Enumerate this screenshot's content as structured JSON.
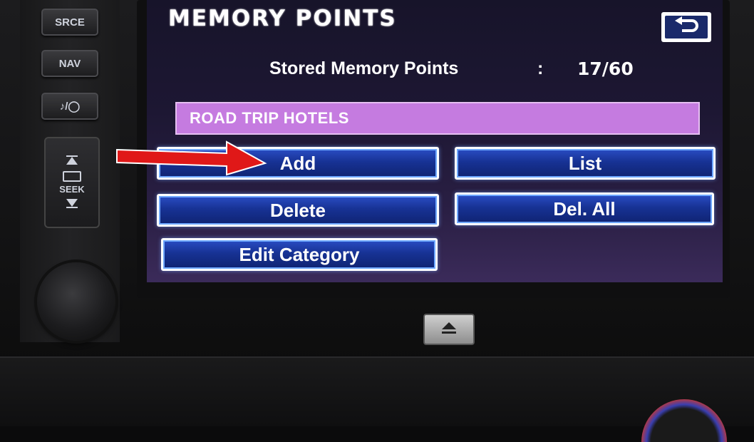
{
  "hardware": {
    "buttons": [
      {
        "id": "srce",
        "label": "SRCE"
      },
      {
        "id": "nav",
        "label": "NAV"
      },
      {
        "id": "audio",
        "label": "♪/◯"
      }
    ],
    "seek_label": "SEEK"
  },
  "screen": {
    "title": "MEMORY POINTS",
    "stored_label": "Stored Memory Points",
    "stored_sep": ":",
    "stored_count": "17/60",
    "category": "ROAD TRIP HOTELS",
    "buttons": {
      "add": "Add",
      "list": "List",
      "delete": "Delete",
      "del_all": "Del. All",
      "edit_category": "Edit Category"
    }
  },
  "colors": {
    "button_blue": "#173294",
    "category_purple": "#c57be0",
    "annotation_arrow": "#e01818"
  },
  "icons": [
    "back-arrow-icon",
    "eject-icon",
    "seek-up-icon",
    "seek-down-icon",
    "annotation-arrow-icon"
  ]
}
